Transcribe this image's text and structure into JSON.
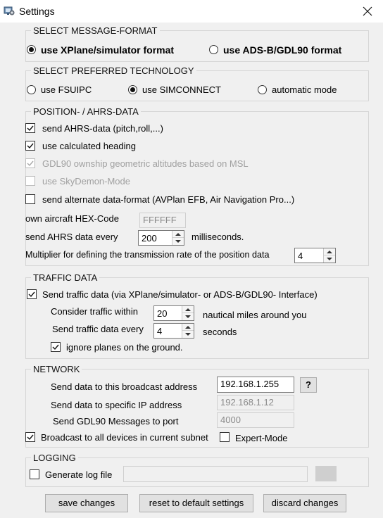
{
  "window": {
    "title": "Settings"
  },
  "message_format": {
    "legend": "SELECT MESSAGE-FORMAT",
    "options": [
      {
        "label": "use XPlane/simulator format",
        "selected": true
      },
      {
        "label": "use ADS-B/GDL90 format",
        "selected": false
      }
    ]
  },
  "technology": {
    "legend": "SELECT PREFERRED TECHNOLOGY",
    "options": [
      {
        "label": "use FSUIPC",
        "selected": false
      },
      {
        "label": "use SIMCONNECT",
        "selected": true
      },
      {
        "label": "automatic mode",
        "selected": false
      }
    ]
  },
  "position": {
    "legend": "POSITION- /  AHRS-DATA",
    "checks": [
      {
        "label": "send AHRS-data (pitch,roll,...)",
        "checked": true,
        "enabled": true
      },
      {
        "label": "use calculated heading",
        "checked": true,
        "enabled": true
      },
      {
        "label": "GDL90 ownship geometric altitudes based on  MSL",
        "checked": true,
        "enabled": false
      },
      {
        "label": "use SkyDemon-Mode",
        "checked": false,
        "enabled": false
      },
      {
        "label": "send alternate data-format (AVPlan EFB, Air Navigation Pro...)",
        "checked": false,
        "enabled": true
      }
    ],
    "hex_label": "own aircraft HEX-Code",
    "hex_value": "FFFFFF",
    "ahrs_every_label": "send AHRS data every",
    "ahrs_every_value": "200",
    "ahrs_every_unit": "milliseconds.",
    "multiplier_label": "Multiplier for defining the transmission rate of the position data",
    "multiplier_value": "4"
  },
  "traffic": {
    "legend": "TRAFFIC DATA",
    "send_label": "Send traffic data (via XPlane/simulator- or  ADS-B/GDL90- Interface)",
    "send_checked": true,
    "within_label": "Consider traffic within",
    "within_value": "20",
    "within_unit": "nautical miles around you",
    "every_label": "Send traffic data every",
    "every_value": "4",
    "every_unit": "seconds",
    "ignore_label": "ignore planes on the ground.",
    "ignore_checked": true
  },
  "network": {
    "legend": "NETWORK",
    "broadcast_label": "Send data to this broadcast address",
    "broadcast_value": "192.168.1.255",
    "help_label": "?",
    "specific_label": "Send data to specific IP address",
    "specific_value": "192.168.1.12",
    "port_label": "Send GDL90 Messages to port",
    "port_value": "4000",
    "subnet_label": "Broadcast to all devices in current subnet",
    "subnet_checked": true,
    "expert_label": "Expert-Mode",
    "expert_checked": false
  },
  "logging": {
    "legend": "LOGGING",
    "generate_label": "Generate log file",
    "generate_checked": false,
    "path_value": ""
  },
  "buttons": {
    "save": "save changes",
    "reset": "reset to default settings",
    "discard": "discard changes"
  },
  "icons": {
    "app": "settings-app-icon",
    "close": "close-icon"
  }
}
